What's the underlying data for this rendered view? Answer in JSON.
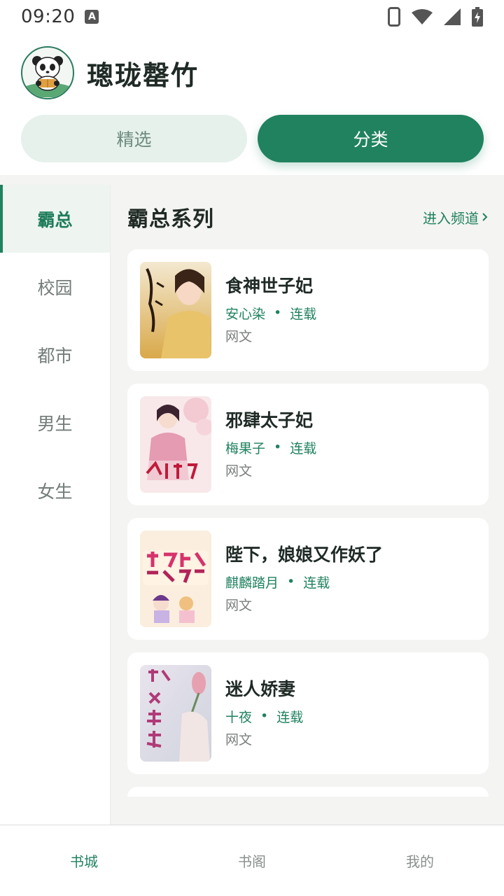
{
  "status_bar": {
    "time": "09:20",
    "notification_badge": "A",
    "icons": [
      "phone-outline-icon",
      "wifi-icon",
      "signal-icon",
      "battery-charging-icon"
    ]
  },
  "header": {
    "title": "璁珑罄竹",
    "avatar_icon": "panda-reading-icon"
  },
  "tabs": [
    {
      "label": "精选",
      "active": false
    },
    {
      "label": "分类",
      "active": true
    }
  ],
  "sidebar": {
    "items": [
      {
        "label": "霸总",
        "active": true
      },
      {
        "label": "校园",
        "active": false
      },
      {
        "label": "都市",
        "active": false
      },
      {
        "label": "男生",
        "active": false
      },
      {
        "label": "女生",
        "active": false
      }
    ]
  },
  "section": {
    "title": "霸总系列",
    "more_label": "进入频道",
    "more_icon": "chevron-right-icon"
  },
  "books": [
    {
      "title": "食神世子妃",
      "author": "安心染",
      "status": "连载",
      "genre": "网文"
    },
    {
      "title": "邪肆太子妃",
      "author": "梅果子",
      "status": "连载",
      "genre": "网文"
    },
    {
      "title": "陛下，娘娘又作妖了",
      "author": "麒麟踏月",
      "status": "连载",
      "genre": "网文"
    },
    {
      "title": "迷人娇妻",
      "author": "十夜",
      "status": "连载",
      "genre": "网文"
    }
  ],
  "bottom_nav": [
    {
      "label": "书城",
      "active": true
    },
    {
      "label": "书阁",
      "active": false
    },
    {
      "label": "我的",
      "active": false
    }
  ],
  "colors": {
    "accent": "#20825f",
    "tab_inactive_bg": "#e6f1ec",
    "content_bg": "#f4f4f2"
  }
}
